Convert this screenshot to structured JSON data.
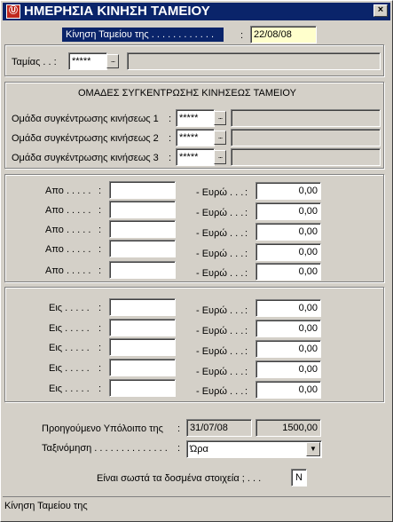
{
  "window": {
    "title": "ΗΜΕΡΗΣΙΑ ΚΙΝΗΣΗ ΤΑΜΕΙΟΥ",
    "icon_name": "app-logo-icon",
    "close_glyph": "×"
  },
  "header": {
    "label": "Κίνηση Ταμείου της . . . . . . . . . . . .",
    "colon": ":",
    "date_value": "22/08/08"
  },
  "cashier": {
    "label": "Ταμίας . . :",
    "code_value": "*****",
    "lookup_glyph": "...",
    "description_value": ""
  },
  "groups": {
    "title": "ΟΜΑΔΕΣ ΣΥΓΚΕΝΤΡΩΣΗΣ ΚΙΝΗΣΕΩΣ ΤΑΜΕΙΟΥ",
    "items": [
      {
        "label": "Ομάδα συγκέντρωσης κινήσεως 1",
        "colon": ":",
        "code": "*****",
        "lookup": "...",
        "description": ""
      },
      {
        "label": "Ομάδα συγκέντρωσης κινήσεως 2",
        "colon": ":",
        "code": "*****",
        "lookup": "...",
        "description": ""
      },
      {
        "label": "Ομάδα συγκέντρωσης κινήσεως 3",
        "colon": ":",
        "code": "*****",
        "lookup": "...",
        "description": ""
      }
    ]
  },
  "from_rows": [
    {
      "label": "Απο . . . . .",
      "colon": ":",
      "value": "",
      "euro_label": "- Ευρώ . . .",
      "euro_colon": ":",
      "amount": "0,00"
    },
    {
      "label": "Απο . . . . .",
      "colon": ":",
      "value": "",
      "euro_label": "- Ευρώ . . .",
      "euro_colon": ":",
      "amount": "0,00"
    },
    {
      "label": "Απο . . . . .",
      "colon": ":",
      "value": "",
      "euro_label": "- Ευρώ . . .",
      "euro_colon": ":",
      "amount": "0,00"
    },
    {
      "label": "Απο . . . . .",
      "colon": ":",
      "value": "",
      "euro_label": "- Ευρώ . . .",
      "euro_colon": ":",
      "amount": "0,00"
    },
    {
      "label": "Απο . . . . .",
      "colon": ":",
      "value": "",
      "euro_label": "- Ευρώ . . .",
      "euro_colon": ":",
      "amount": "0,00"
    }
  ],
  "to_rows": [
    {
      "label": "Εις . . . . .",
      "colon": ":",
      "value": "",
      "euro_label": "- Ευρώ . . .",
      "euro_colon": ":",
      "amount": "0,00"
    },
    {
      "label": "Εις . . . . .",
      "colon": ":",
      "value": "",
      "euro_label": "- Ευρώ . . .",
      "euro_colon": ":",
      "amount": "0,00"
    },
    {
      "label": "Εις . . . . .",
      "colon": ":",
      "value": "",
      "euro_label": "- Ευρώ . . .",
      "euro_colon": ":",
      "amount": "0,00"
    },
    {
      "label": "Εις . . . . .",
      "colon": ":",
      "value": "",
      "euro_label": "- Ευρώ . . .",
      "euro_colon": ":",
      "amount": "0,00"
    },
    {
      "label": "Εις . . . . .",
      "colon": ":",
      "value": "",
      "euro_label": "- Ευρώ . . .",
      "euro_colon": ":",
      "amount": "0,00"
    }
  ],
  "previous_balance": {
    "label": "Προηγούμενο Υπόλοιπο της",
    "colon": ":",
    "date": "31/07/08",
    "amount": "1500,00"
  },
  "sort": {
    "label": "Ταξινόμηση . . . . . . . . . . . . . .",
    "colon": ":",
    "selected": "Ώρα",
    "dropdown_glyph": "▼"
  },
  "confirm": {
    "label": "Είναι σωστά τα δοσμένα στοιχεία ; . . .",
    "value": "N"
  },
  "status": {
    "text": "Κίνηση Ταμείου της"
  }
}
